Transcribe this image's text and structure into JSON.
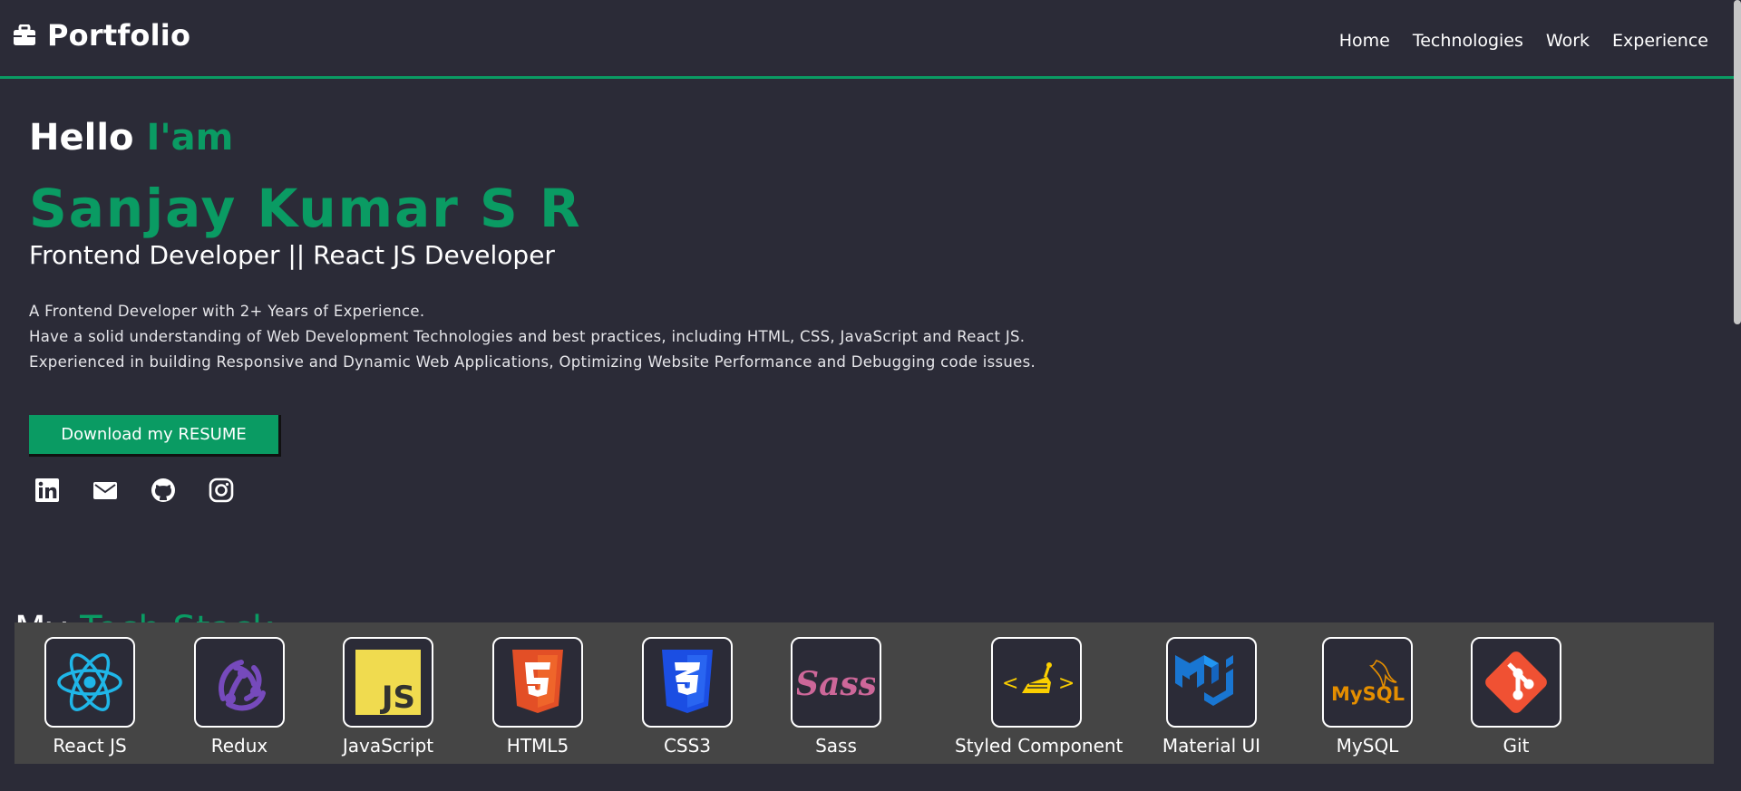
{
  "brand": {
    "title": "Portfolio",
    "icon": "briefcase-icon"
  },
  "nav": {
    "items": [
      "Home",
      "Technologies",
      "Work",
      "Experience"
    ]
  },
  "hero": {
    "greeting_prefix": "Hello",
    "greeting_accent": "I'am",
    "name": "Sanjay Kumar S R",
    "role": "Frontend Developer || React JS Developer",
    "bio": [
      "A Frontend Developer with 2+ Years of Experience.",
      "Have a solid understanding of Web Development Technologies and best practices, including HTML, CSS, JavaScript and React JS.",
      "Experienced in building Responsive and Dynamic Web Applications, Optimizing Website Performance and Debugging code issues."
    ],
    "resume_button": "Download my RESUME",
    "socials": [
      "linkedin-icon",
      "email-icon",
      "github-icon",
      "instagram-icon"
    ]
  },
  "tech": {
    "title_prefix": "My",
    "title_accent": "Tech Stack",
    "items": [
      {
        "label": "React JS",
        "icon": "react-icon"
      },
      {
        "label": "Redux",
        "icon": "redux-icon"
      },
      {
        "label": "JavaScript",
        "icon": "javascript-icon"
      },
      {
        "label": "HTML5",
        "icon": "html5-icon"
      },
      {
        "label": "CSS3",
        "icon": "css3-icon"
      },
      {
        "label": "Sass",
        "icon": "sass-icon"
      },
      {
        "label": "Styled Component",
        "icon": "styled-components-icon"
      },
      {
        "label": "Material UI",
        "icon": "material-ui-icon"
      },
      {
        "label": "MySQL",
        "icon": "mysql-icon"
      },
      {
        "label": "Git",
        "icon": "git-icon"
      }
    ]
  },
  "colors": {
    "background": "#2b2b37",
    "accent": "#0a9b63",
    "panel": "#454545"
  }
}
